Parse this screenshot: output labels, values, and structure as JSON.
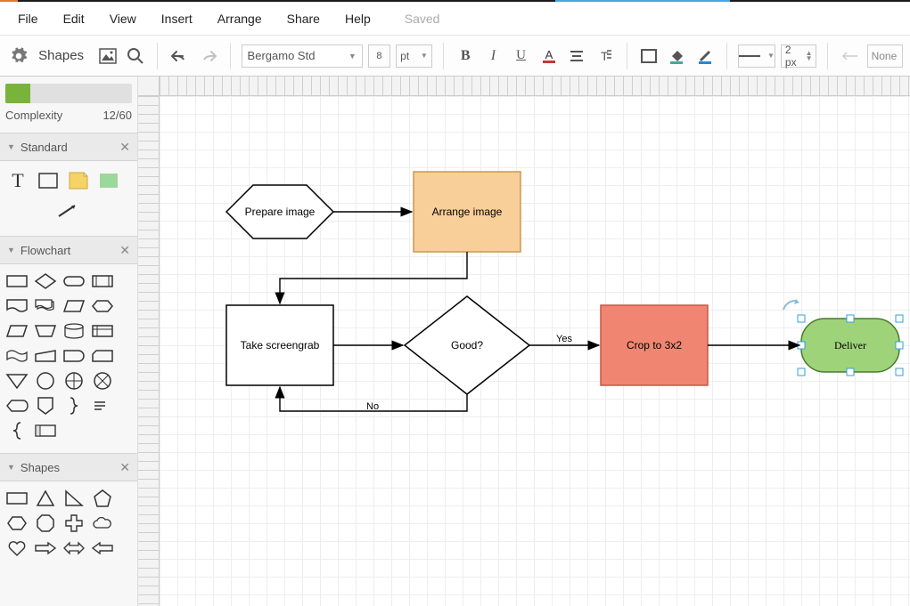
{
  "menu": {
    "file": "File",
    "edit": "Edit",
    "view": "View",
    "insert": "Insert",
    "arrange": "Arrange",
    "share": "Share",
    "help": "Help",
    "saved": "Saved"
  },
  "toolbar": {
    "shapes_label": "Shapes",
    "font": "Bergamo Std",
    "font_size": "8",
    "unit": "pt",
    "line_width": "2 px",
    "arrow_end": "None"
  },
  "sidebar": {
    "complexity_label": "Complexity",
    "complexity_value": "12/60",
    "panels": {
      "standard": {
        "title": "Standard"
      },
      "flowchart": {
        "title": "Flowchart"
      },
      "shapes": {
        "title": "Shapes"
      }
    }
  },
  "diagram": {
    "nodes": {
      "prepare": {
        "label": "Prepare image"
      },
      "arrange": {
        "label": "Arrange image"
      },
      "take": {
        "label": "Take screengrab"
      },
      "good": {
        "label": "Good?"
      },
      "crop": {
        "label": "Crop to 3x2"
      },
      "deliver": {
        "label": "Deliver"
      }
    },
    "edges": {
      "yes": "Yes",
      "no": "No"
    }
  }
}
